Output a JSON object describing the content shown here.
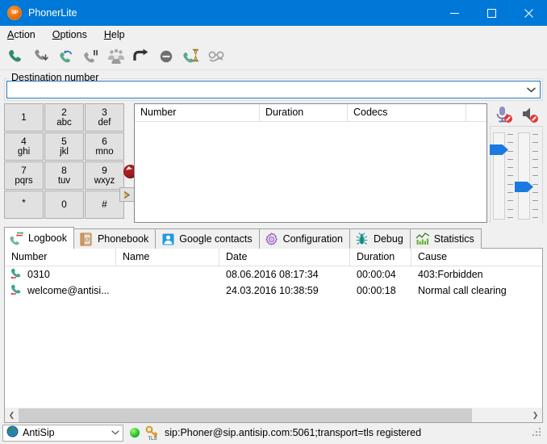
{
  "window": {
    "title": "PhonerLite",
    "icon": "sip-logo-icon",
    "minimize_label": "Minimize",
    "maximize_label": "Maximize",
    "close_label": "Close"
  },
  "menu": [
    {
      "label": "Action",
      "accel": "A"
    },
    {
      "label": "Options",
      "accel": "O"
    },
    {
      "label": "Help",
      "accel": "H"
    }
  ],
  "toolbar": [
    {
      "name": "call-icon",
      "title": "Call"
    },
    {
      "name": "hangup-icon",
      "title": "Hang up"
    },
    {
      "name": "redial-icon",
      "title": "Redial"
    },
    {
      "name": "hold-icon",
      "title": "Hold"
    },
    {
      "name": "conference-icon",
      "title": "Conference"
    },
    {
      "name": "transfer-icon",
      "title": "Transfer"
    },
    {
      "name": "reject-icon",
      "title": "Reject"
    },
    {
      "name": "waiting-call-icon",
      "title": "Call waiting"
    },
    {
      "name": "do-not-disturb-icon",
      "title": "Do not disturb"
    }
  ],
  "destination": {
    "legend": "Destination number",
    "legend_accel": "D",
    "value": "",
    "placeholder": "",
    "dropdown_icon": "chevron-down-icon"
  },
  "dialpad": {
    "keys": [
      {
        "digit": "1",
        "letters": ""
      },
      {
        "digit": "2",
        "letters": "abc"
      },
      {
        "digit": "3",
        "letters": "def"
      },
      {
        "digit": "4",
        "letters": "ghi"
      },
      {
        "digit": "5",
        "letters": "jkl"
      },
      {
        "digit": "6",
        "letters": "mno"
      },
      {
        "digit": "7",
        "letters": "pqrs"
      },
      {
        "digit": "8",
        "letters": "tuv"
      },
      {
        "digit": "9",
        "letters": "wxyz"
      },
      {
        "digit": "*",
        "letters": ""
      },
      {
        "digit": "0",
        "letters": ""
      },
      {
        "digit": "#",
        "letters": ""
      }
    ],
    "record_button": "record-icon",
    "send_button_label": ">"
  },
  "calllist": {
    "columns": [
      "Number",
      "Duration",
      "Codecs",
      ""
    ],
    "rows": []
  },
  "audio": {
    "mic_icon": "microphone-muted-icon",
    "speaker_icon": "speaker-muted-icon",
    "mic_slider_value": 82,
    "speaker_slider_value": 38
  },
  "tabs": [
    {
      "label": "Logbook",
      "icon": "logbook-phone-icon",
      "active": true
    },
    {
      "label": "Phonebook",
      "icon": "phonebook-icon",
      "active": false
    },
    {
      "label": "Google contacts",
      "icon": "google-contacts-icon",
      "active": false
    },
    {
      "label": "Configuration",
      "icon": "gear-icon",
      "active": false
    },
    {
      "label": "Debug",
      "icon": "bug-icon",
      "active": false
    },
    {
      "label": "Statistics",
      "icon": "statistics-chart-icon",
      "active": false
    }
  ],
  "logbook": {
    "columns": [
      "Number",
      "Name",
      "Date",
      "Duration",
      "Cause"
    ],
    "rows": [
      {
        "icon": "incoming-call-icon",
        "number": "0310",
        "name": "",
        "date": "08.06.2016 08:17:34",
        "duration": "00:00:04",
        "cause": "403:Forbidden"
      },
      {
        "icon": "incoming-call-icon",
        "number": "welcome@antisi...",
        "name": "",
        "date": "24.03.2016 10:38:59",
        "duration": "00:00:18",
        "cause": "Normal call clearing"
      }
    ]
  },
  "statusbar": {
    "account_icon": "globe-icon",
    "account": "AntiSip",
    "account_dropdown_icon": "chevron-down-icon",
    "registration_status_icon": "status-online-icon",
    "security_icon": "tls-key-icon",
    "status_text": "sip:Phoner@sip.antisip.com:5061;transport=tls registered"
  },
  "colors": {
    "titlebar": "#0078d7",
    "accent": "#1a7ae0",
    "phone_green": "#2e8b6b",
    "record_red": "#9b1b1f",
    "status_green": "#2fc42f"
  }
}
